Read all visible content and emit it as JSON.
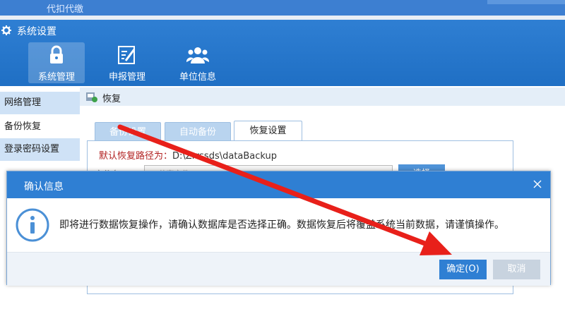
{
  "bg_window": {
    "title": "代扣代缴"
  },
  "app": {
    "title": "系统设置"
  },
  "nav": [
    {
      "label": "系统管理",
      "icon": "lock-icon"
    },
    {
      "label": "申报管理",
      "icon": "edit-document-icon"
    },
    {
      "label": "单位信息",
      "icon": "users-icon"
    }
  ],
  "sidebar": [
    {
      "label": "网络管理"
    },
    {
      "label": "备份恢复"
    },
    {
      "label": "登录密码设置"
    }
  ],
  "content": {
    "header": "恢复",
    "tabs": [
      {
        "label": "备份设置"
      },
      {
        "label": "自动备份"
      },
      {
        "label": "恢复设置"
      }
    ],
    "restore_path_label": "默认恢复路径为：",
    "restore_path_value": "D:\\Zrrssds\\dataBackup",
    "file_label": "文件名",
    "file_value": "E:\\共享文件\\Backup\\...\\DBFILE_20211025003326.bak",
    "select_button": "选择"
  },
  "dialog": {
    "title": "确认信息",
    "message": "即将进行数据恢复操作，请确认数据库是否选择正确。数据恢复后将覆盖系统当前数据，请谨慎操作。",
    "ok": "确定(O)",
    "cancel": "取消"
  },
  "colors": {
    "accent": "#2f7fd3",
    "arrow": "#e8201a",
    "path_red": "#b22222"
  }
}
